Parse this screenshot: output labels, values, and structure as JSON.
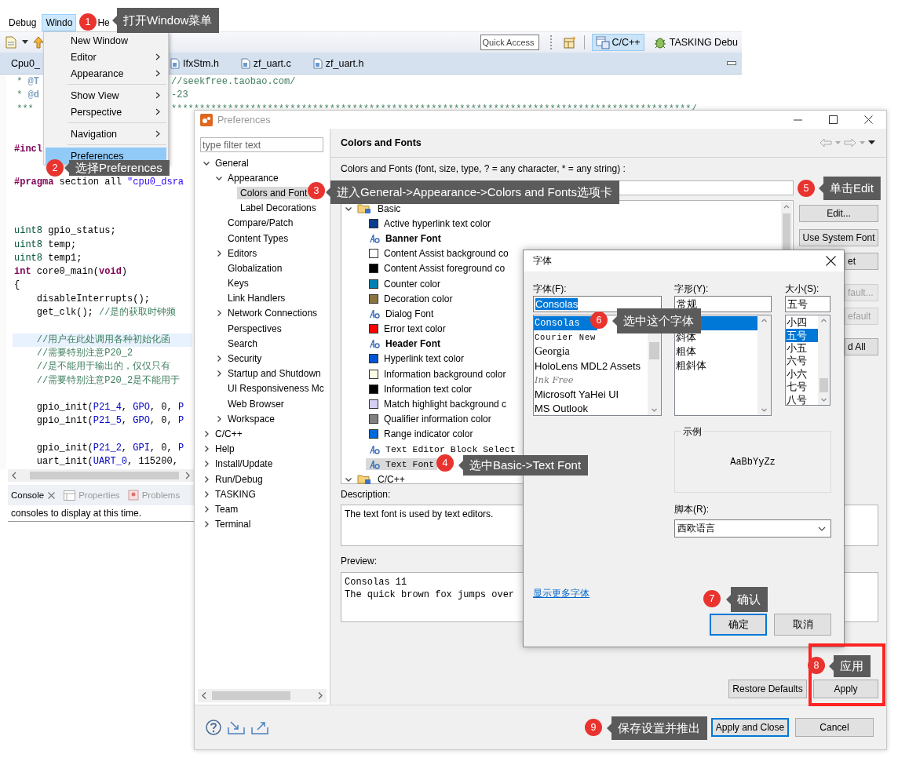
{
  "eclipse": {
    "menubar": [
      {
        "label": "Debug",
        "selected": false
      },
      {
        "label": "Windo",
        "selected": true
      },
      {
        "label": "He",
        "selected": false
      }
    ],
    "window_menu": [
      {
        "kind": "item",
        "label": "New Window",
        "submenu": false,
        "selected": false
      },
      {
        "kind": "item",
        "label": "Editor",
        "submenu": true,
        "selected": false
      },
      {
        "kind": "item",
        "label": "Appearance",
        "submenu": true,
        "selected": false
      },
      {
        "kind": "separator"
      },
      {
        "kind": "item",
        "label": "Show View",
        "submenu": true,
        "selected": false
      },
      {
        "kind": "item",
        "label": "Perspective",
        "submenu": true,
        "selected": false
      },
      {
        "kind": "separator"
      },
      {
        "kind": "item",
        "label": "Navigation",
        "submenu": true,
        "selected": false
      },
      {
        "kind": "separator"
      },
      {
        "kind": "item",
        "label": "Preferences",
        "submenu": false,
        "selected": true
      }
    ],
    "toolbar": {
      "quick_access": {
        "placeholder": "Quick Access"
      },
      "perspectives": [
        {
          "label": "C/C++",
          "kind": "c",
          "selected": true
        },
        {
          "label": "TASKING Debu",
          "kind": "debug",
          "selected": false
        }
      ]
    },
    "editor_tabs": {
      "active": "Cpu0_",
      "tabs": [
        "IfxStm.h",
        "zf_uart.c",
        "zf_uart.h"
      ]
    },
    "header_lines": [
      {
        "left": [
          {
            "text": " * ",
            "kind": "comment"
          },
          {
            "text": "@T",
            "kind": "tag"
          }
        ],
        "right": [
          {
            "text": "//seekfree.taobao.com/",
            "kind": "comment"
          }
        ]
      },
      {
        "left": [
          {
            "text": " * ",
            "kind": "comment"
          },
          {
            "text": "@d",
            "kind": "tag"
          }
        ],
        "right": [
          {
            "text": "-23",
            "kind": "comment"
          }
        ]
      },
      {
        "left": [
          {
            "text": " ***",
            "kind": "comment"
          }
        ],
        "right": [
          {
            "text": "********************************************************************************************/",
            "kind": "comment"
          }
        ]
      }
    ],
    "code": [
      [
        {
          "tokens": [
            {
              "text": "#incl",
              "kind": "pre"
            }
          ],
          "current": false
        }
      ],
      [
        {
          "tokens": [
            {
              "text": "#pragma",
              "kind": "pre"
            },
            {
              "text": " section all ",
              "kind": "plain"
            },
            {
              "text": "\"cpu0_dsra",
              "kind": "str"
            }
          ],
          "current": false
        }
      ],
      [
        {
          "tokens": [
            {
              "text": "uint8",
              "kind": "type"
            },
            {
              "text": " gpio_status;",
              "kind": "plain"
            }
          ],
          "current": false
        },
        {
          "tokens": [
            {
              "text": "uint8",
              "kind": "type"
            },
            {
              "text": " temp;",
              "kind": "plain"
            }
          ],
          "current": false
        },
        {
          "tokens": [
            {
              "text": "uint8",
              "kind": "type"
            },
            {
              "text": " temp1;",
              "kind": "plain"
            }
          ],
          "current": false
        },
        {
          "tokens": [
            {
              "text": "int",
              "kind": "kw"
            },
            {
              "text": " core0_main(",
              "kind": "plain"
            },
            {
              "text": "void",
              "kind": "kw"
            },
            {
              "text": ")",
              "kind": "plain"
            }
          ],
          "current": false
        },
        {
          "tokens": [
            {
              "text": "{",
              "kind": "plain"
            }
          ],
          "current": false
        },
        {
          "tokens": [
            {
              "text": "    disableInterrupts();",
              "kind": "plain"
            }
          ],
          "current": false
        },
        {
          "tokens": [
            {
              "text": "    get_clk(); ",
              "kind": "plain"
            },
            {
              "text": "//是的获取时钟频",
              "kind": "comment"
            }
          ],
          "current": false
        }
      ],
      [
        {
          "tokens": [
            {
              "text": "    //用户在此处调用各种初始化函",
              "kind": "comment"
            }
          ],
          "current": true
        },
        {
          "tokens": [
            {
              "text": "    //需要特别注意P20_2",
              "kind": "comment"
            }
          ],
          "current": false
        },
        {
          "tokens": [
            {
              "text": "    //是不能用于输出的，仅仅只有",
              "kind": "comment"
            }
          ],
          "current": false
        },
        {
          "tokens": [
            {
              "text": "    //需要特别注意P20_2是不能用于",
              "kind": "comment"
            }
          ],
          "current": false
        }
      ],
      [
        {
          "tokens": [
            {
              "text": "    gpio_init(",
              "kind": "plain"
            },
            {
              "text": "P21_4",
              "kind": "const"
            },
            {
              "text": ", ",
              "kind": "plain"
            },
            {
              "text": "GPO",
              "kind": "const"
            },
            {
              "text": ", 0, ",
              "kind": "plain"
            },
            {
              "text": "P",
              "kind": "const"
            }
          ],
          "current": false
        },
        {
          "tokens": [
            {
              "text": "    gpio_init(",
              "kind": "plain"
            },
            {
              "text": "P21_5",
              "kind": "const"
            },
            {
              "text": ", ",
              "kind": "plain"
            },
            {
              "text": "GPO",
              "kind": "const"
            },
            {
              "text": ", 0, ",
              "kind": "plain"
            },
            {
              "text": "P",
              "kind": "const"
            }
          ],
          "current": false
        }
      ],
      [
        {
          "tokens": [
            {
              "text": "    gpio_init(",
              "kind": "plain"
            },
            {
              "text": "P21_2",
              "kind": "const"
            },
            {
              "text": ", ",
              "kind": "plain"
            },
            {
              "text": "GPI",
              "kind": "const"
            },
            {
              "text": ", 0, ",
              "kind": "plain"
            },
            {
              "text": "P",
              "kind": "const"
            }
          ],
          "current": false
        },
        {
          "tokens": [
            {
              "text": "    uart_init(",
              "kind": "plain"
            },
            {
              "text": "UART_0",
              "kind": "const"
            },
            {
              "text": ", 115200,",
              "kind": "plain"
            }
          ],
          "current": false
        }
      ]
    ],
    "console": {
      "tabs": [
        {
          "label": "Console",
          "selected": true
        },
        {
          "label": "Properties",
          "selected": false
        },
        {
          "label": "Problems",
          "selected": false
        }
      ],
      "message": "consoles to display at this time."
    }
  },
  "preferences": {
    "title": "Preferences",
    "filter": {
      "placeholder": "type filter text"
    },
    "tree": [
      {
        "label": "General",
        "expanded": true,
        "selected": false,
        "children": [
          {
            "label": "Appearance",
            "expanded": true,
            "selected": false,
            "children": [
              {
                "label": "Colors and Font",
                "selected": true
              },
              {
                "label": "Label Decorations",
                "selected": false
              }
            ]
          },
          {
            "label": "Compare/Patch",
            "selected": false
          },
          {
            "label": "Content Types",
            "selected": false
          },
          {
            "label": "Editors",
            "expanded": false,
            "selected": false
          },
          {
            "label": "Globalization",
            "selected": false
          },
          {
            "label": "Keys",
            "selected": false
          },
          {
            "label": "Link Handlers",
            "selected": false
          },
          {
            "label": "Network Connections",
            "expanded": false,
            "selected": false
          },
          {
            "label": "Perspectives",
            "selected": false
          },
          {
            "label": "Search",
            "selected": false
          },
          {
            "label": "Security",
            "expanded": false,
            "selected": false
          },
          {
            "label": "Startup and Shutdown",
            "expanded": false,
            "selected": false
          },
          {
            "label": "UI Responsiveness Mc",
            "selected": false
          },
          {
            "label": "Web Browser",
            "selected": false
          },
          {
            "label": "Workspace",
            "expanded": false,
            "selected": false
          }
        ]
      },
      {
        "label": "C/C++",
        "expanded": false,
        "selected": false
      },
      {
        "label": "Help",
        "expanded": false,
        "selected": false
      },
      {
        "label": "Install/Update",
        "expanded": false,
        "selected": false
      },
      {
        "label": "Run/Debug",
        "expanded": false,
        "selected": false
      },
      {
        "label": "TASKING",
        "expanded": false,
        "selected": false
      },
      {
        "label": "Team",
        "expanded": false,
        "selected": false
      },
      {
        "label": "Terminal",
        "expanded": false,
        "selected": false
      }
    ],
    "page": {
      "title": "Colors and Fonts",
      "hint": "Colors and Fonts (font, size, type, ? = any character, * = any string) :",
      "groups": [
        {
          "label": "Basic",
          "expanded": true,
          "items": [
            {
              "label": "Active hyperlink text color",
              "kind": "color",
              "color": "#0b3d91",
              "selected": false
            },
            {
              "label": "Banner Font",
              "kind": "boldfont",
              "selected": false
            },
            {
              "label": "Content Assist background co",
              "kind": "color",
              "color": "#ffffff",
              "selected": false
            },
            {
              "label": "Content Assist foreground co",
              "kind": "color",
              "color": "#000000",
              "selected": false
            },
            {
              "label": "Counter color",
              "kind": "color",
              "color": "#0080b0",
              "selected": false
            },
            {
              "label": "Decoration color",
              "kind": "color",
              "color": "#8b7340",
              "selected": false
            },
            {
              "label": "Dialog Font",
              "kind": "font",
              "selected": false
            },
            {
              "label": "Error text color",
              "kind": "color",
              "color": "#ff0000",
              "selected": false
            },
            {
              "label": "Header Font",
              "kind": "boldfont",
              "selected": false
            },
            {
              "label": "Hyperlink text color",
              "kind": "color",
              "color": "#0055d4",
              "selected": false
            },
            {
              "label": "Information background color",
              "kind": "color",
              "color": "#fffde6",
              "selected": false
            },
            {
              "label": "Information text color",
              "kind": "color",
              "color": "#000000",
              "selected": false
            },
            {
              "label": "Match highlight background c",
              "kind": "color",
              "color": "#d4d0f5",
              "selected": false
            },
            {
              "label": "Qualifier information color",
              "kind": "color",
              "color": "#808080",
              "selected": false
            },
            {
              "label": "Range indicator color",
              "kind": "color",
              "color": "#0068dd",
              "selected": false
            },
            {
              "label": "Text Editor Block Select",
              "kind": "monofont",
              "selected": false
            },
            {
              "label": "Text Font",
              "kind": "monofont",
              "selected": true
            }
          ]
        },
        {
          "label": "C/C++",
          "expanded": true
        }
      ],
      "buttons": [
        {
          "label": "Edit...",
          "kind": "full",
          "disabled": false
        },
        {
          "label": "Use System Font",
          "kind": "full",
          "disabled": false
        },
        {
          "label": "et",
          "kind": "partial",
          "disabled": false
        },
        {
          "label": "fault...",
          "kind": "partial",
          "disabled": true
        },
        {
          "label": "efault",
          "kind": "partial",
          "disabled": true
        },
        {
          "label": "d All",
          "kind": "partial",
          "disabled": false
        }
      ],
      "description_label": "Description:",
      "description": "The text font is used by text editors.",
      "preview_label": "Preview:",
      "preview": [
        "Consolas 11",
        "The quick brown fox jumps over"
      ],
      "restore_button": "Restore Defaults",
      "apply_button": "Apply"
    },
    "footer_buttons": [
      {
        "label": "Apply and Close",
        "default": true
      },
      {
        "label": "Cancel",
        "default": false
      }
    ]
  },
  "font_dialog": {
    "title": "字体",
    "family_label": "字体(F):",
    "style_label": "字形(Y):",
    "size_label": "大小(S):",
    "family": {
      "value": "Consolas",
      "highlighted": true
    },
    "style": {
      "value": "常规"
    },
    "size": {
      "value": "五号"
    },
    "families": [
      {
        "label": "Consolas",
        "kind": "mono",
        "selected": true
      },
      {
        "label": "Courier New",
        "kind": "courier",
        "selected": false
      },
      {
        "label": "Georgia",
        "kind": "serif",
        "selected": false
      },
      {
        "label": "HoloLens MDL2 Assets",
        "kind": "sans",
        "selected": false
      },
      {
        "label": "Ink Free",
        "kind": "script",
        "selected": false
      },
      {
        "label": "Microsoft YaHei UI",
        "kind": "sans",
        "selected": false
      },
      {
        "label": "MS Outlook",
        "kind": "sans",
        "selected": false
      }
    ],
    "styles": [
      {
        "selected": true
      },
      {
        "label": "斜体",
        "selected": false
      },
      {
        "label": "粗体",
        "selected": false
      },
      {
        "label": "粗斜体",
        "selected": false
      }
    ],
    "sizes": [
      {
        "label": "小四",
        "selected": false
      },
      {
        "label": "五号",
        "selected": true
      },
      {
        "label": "小五",
        "selected": false
      },
      {
        "label": "六号",
        "selected": false
      },
      {
        "label": "小六",
        "selected": false
      },
      {
        "label": "七号",
        "selected": false
      },
      {
        "label": "八号",
        "selected": false
      }
    ],
    "sample_label": "示例",
    "sample": "AaBbYyZz",
    "script_label": "脚本(R):",
    "script": "西欧语言",
    "more_link": "显示更多字体",
    "buttons": [
      {
        "label": "确定",
        "default": true
      },
      {
        "label": "取消",
        "default": false
      }
    ]
  },
  "callouts": [
    {
      "number": "1",
      "text": "打开Window菜单"
    },
    {
      "number": "2",
      "text": "选择Preferences"
    },
    {
      "number": "3",
      "text": "进入General->Appearance->Colors and Fonts选项卡"
    },
    {
      "number": "4",
      "text": "选中Basic->Text Font"
    },
    {
      "number": "5",
      "text": "单击Edit"
    },
    {
      "number": "6",
      "text": "选中这个字体"
    },
    {
      "number": "7",
      "text": "确认"
    },
    {
      "number": "8",
      "text": "应用"
    },
    {
      "number": "9",
      "text": "保存设置并推出"
    }
  ]
}
